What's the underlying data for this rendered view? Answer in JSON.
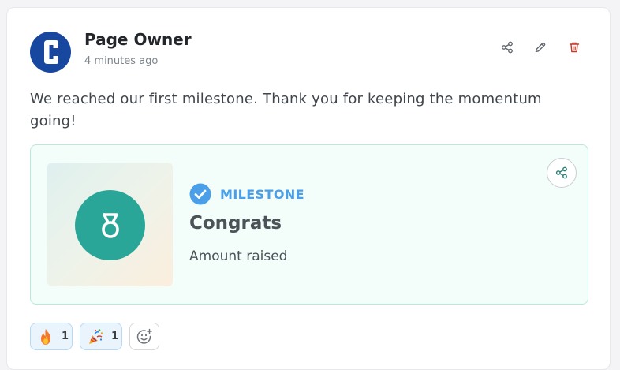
{
  "post": {
    "author": "Page Owner",
    "avatar_letter": "C",
    "timestamp": "4 minutes ago",
    "body": "We reached our first milestone. Thank you for keeping the momentum going!"
  },
  "actions": {
    "icons": [
      "share-icon",
      "edit-icon",
      "trash-icon"
    ]
  },
  "milestone": {
    "badge": "MILESTONE",
    "title": "Congrats",
    "subtitle": "Amount raised"
  },
  "reactions": [
    {
      "emoji": "fire",
      "count": "1"
    },
    {
      "emoji": "party-popper",
      "count": "1"
    }
  ],
  "colors": {
    "avatar_bg": "#17479e",
    "medal": "#2aa699",
    "badge_text": "#4a9fe8",
    "delete": "#c0392b",
    "milestone_bg": "#f3fefb"
  }
}
